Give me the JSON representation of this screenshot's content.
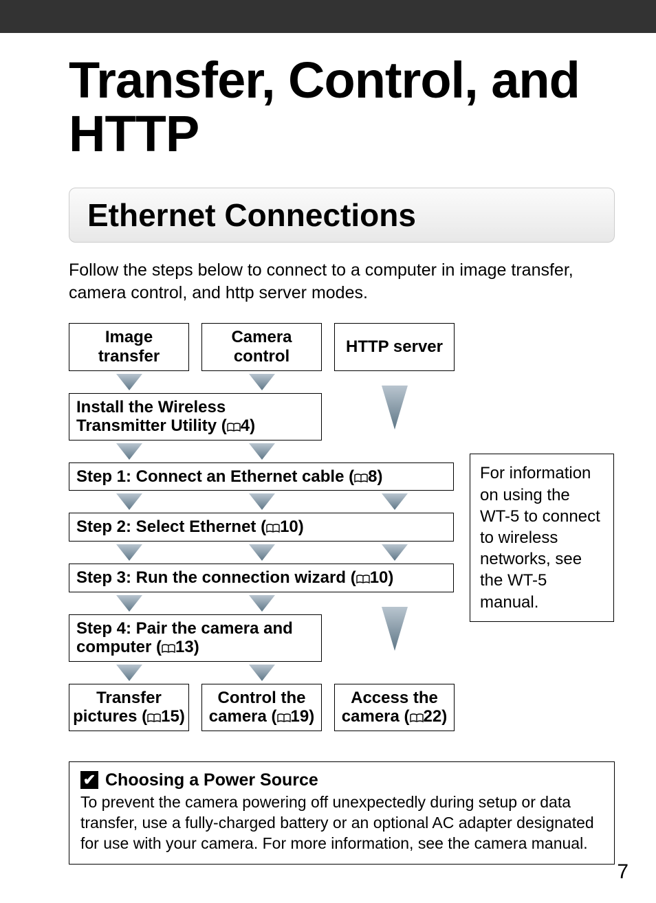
{
  "title": "Transfer, Control, and HTTP",
  "section_heading": "Ethernet Connections",
  "intro": "Follow the steps below to connect to a computer in image transfer, camera control, and http server modes.",
  "columns": {
    "image_transfer": "Image transfer",
    "camera_control": "Camera control",
    "http_server": "HTTP server"
  },
  "install_box_prefix": "Install the Wireless Transmitter Utility (",
  "install_box_ref": "4",
  "install_box_suffix": ")",
  "step1_prefix": "Step 1: Connect an Ethernet cable (",
  "step1_ref": "8",
  "step1_suffix": ")",
  "step2_prefix": "Step 2: Select Ethernet (",
  "step2_ref": "10",
  "step2_suffix": ")",
  "step3_prefix": "Step 3: Run the connection wizard (",
  "step3_ref": "10",
  "step3_suffix": ")",
  "step4_prefix": "Step 4: Pair the camera and  computer (",
  "step4_ref": "13",
  "step4_suffix": ")",
  "final": {
    "transfer_prefix": "Transfer pictures (",
    "transfer_ref": "15",
    "transfer_suffix": ")",
    "control_prefix": "Control the camera (",
    "control_ref": "19",
    "control_suffix": ")",
    "access_prefix": "Access the camera (",
    "access_ref": "22",
    "access_suffix": ")"
  },
  "aside": "For information on using the WT-5 to connect to wireless networks, see the WT-5 manual.",
  "callout": {
    "title": "Choosing a Power Source",
    "body": "To prevent the camera powering off unexpectedly during setup or data transfer, use a fully-charged battery or an optional AC adapter designated for use with your camera. For more information, see the camera manual."
  },
  "page_number": "7"
}
